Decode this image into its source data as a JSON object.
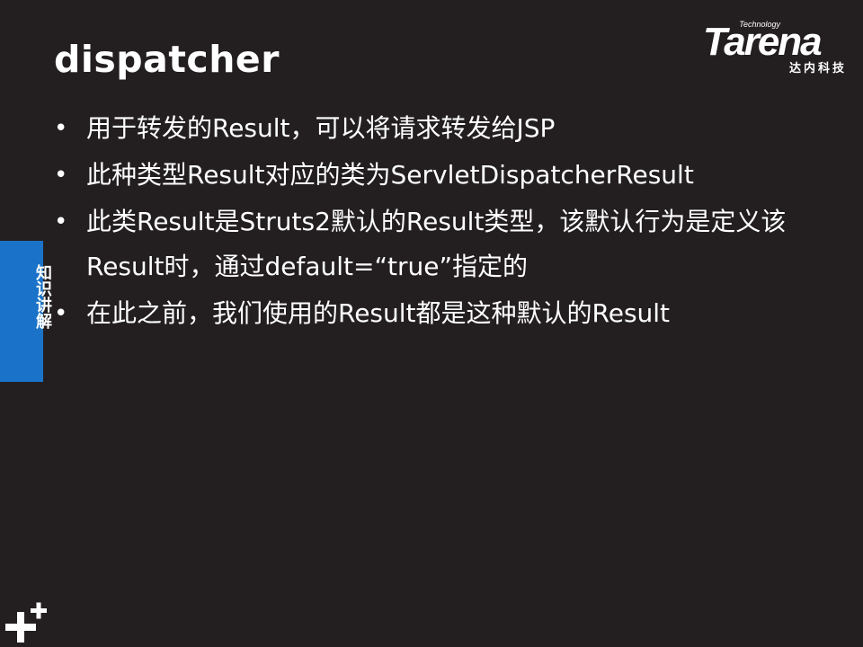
{
  "slide": {
    "title": "dispatcher",
    "bullets": [
      "用于转发的Result，可以将请求转发给JSP",
      "此种类型Result对应的类为ServletDispatcherResult",
      "此类Result是Struts2默认的Result类型，该默认行为是定义该Result时，通过default=“true”指定的",
      "在此之前，我们使用的Result都是这种默认的Result"
    ],
    "bullet_symbol": "•"
  },
  "logo": {
    "technology": "Technology",
    "name": "Tarena",
    "chinese": "达内科技"
  },
  "side_tab": {
    "label": "知识讲解",
    "color": "#1a73c8"
  },
  "corner_icon": "plus-icon",
  "colors": {
    "background": "#231f20",
    "text": "#ffffff"
  }
}
